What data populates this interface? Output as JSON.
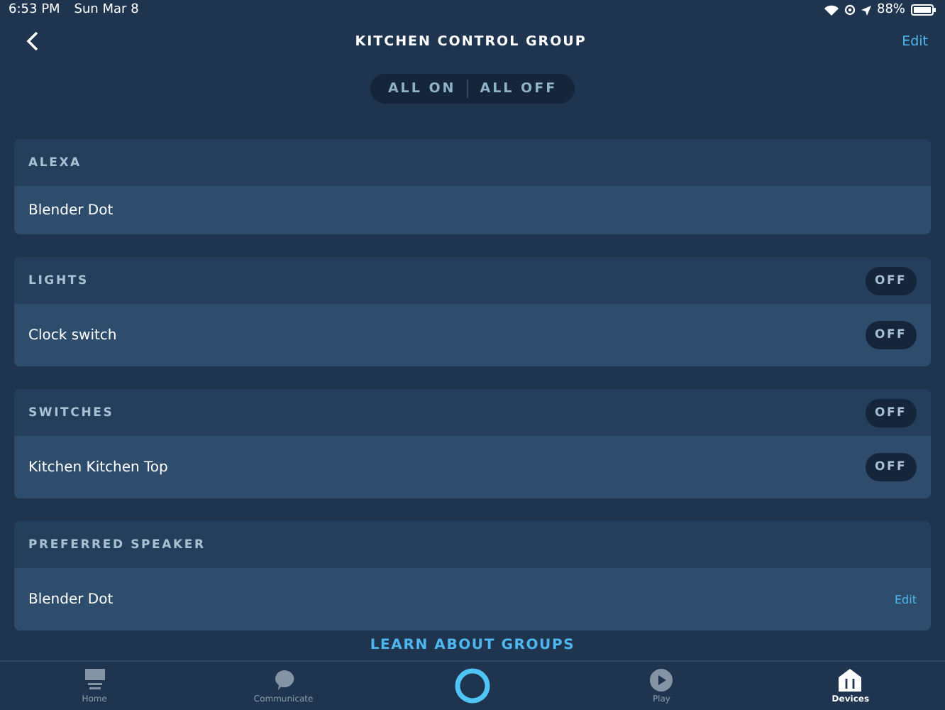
{
  "status_bar": {
    "time": "6:53 PM",
    "date": "Sun Mar 8",
    "battery": "88%"
  },
  "header": {
    "title": "KITCHEN CONTROL GROUP",
    "edit": "Edit"
  },
  "group_controls": [
    "ALL ON",
    "ALL OFF"
  ],
  "sections": [
    {
      "title": "ALEXA",
      "rows": [
        {
          "label": "Blender Dot"
        }
      ]
    },
    {
      "title": "LIGHTS",
      "toggle": {
        "label": "OFF",
        "on": false
      },
      "rows": [
        {
          "label": "Clock switch",
          "toggle": {
            "label": "OFF",
            "on": false
          }
        }
      ]
    },
    {
      "title": "SWITCHES",
      "toggle": {
        "label": "OFF",
        "on": false
      },
      "rows": [
        {
          "label": "Kitchen Kitchen Top",
          "toggle": {
            "label": "OFF",
            "on": false
          }
        }
      ]
    },
    {
      "title": "PREFERRED SPEAKER",
      "rows": [
        {
          "label": "Blender Dot",
          "action": "Edit"
        }
      ]
    }
  ],
  "learn_link": "LEARN ABOUT GROUPS",
  "tabs": [
    {
      "kind": "home",
      "label": "Home",
      "selected": false
    },
    {
      "kind": "communicate",
      "label": "Communicate",
      "selected": false
    },
    {
      "kind": "alexa",
      "selected": false
    },
    {
      "kind": "play",
      "label": "Play",
      "selected": false
    },
    {
      "kind": "devices",
      "label": "Devices",
      "selected": true
    }
  ]
}
